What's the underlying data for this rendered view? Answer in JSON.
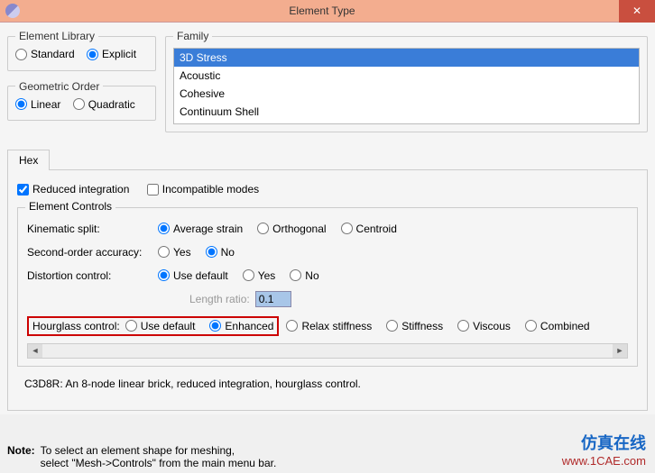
{
  "window": {
    "title": "Element Type",
    "close": "✕"
  },
  "library": {
    "legend": "Element Library",
    "standard": "Standard",
    "explicit": "Explicit"
  },
  "family": {
    "legend": "Family",
    "items": [
      "3D Stress",
      "Acoustic",
      "Cohesive",
      "Continuum Shell"
    ]
  },
  "order": {
    "legend": "Geometric Order",
    "linear": "Linear",
    "quadratic": "Quadratic"
  },
  "tab": {
    "hex": "Hex"
  },
  "checks": {
    "reduced": "Reduced integration",
    "incompatible": "Incompatible modes"
  },
  "controls": {
    "legend": "Element Controls",
    "kin": {
      "label": "Kinematic split:",
      "avg": "Average strain",
      "orth": "Orthogonal",
      "cent": "Centroid"
    },
    "so": {
      "label": "Second-order accuracy:",
      "yes": "Yes",
      "no": "No"
    },
    "dist": {
      "label": "Distortion control:",
      "def": "Use default",
      "yes": "Yes",
      "no": "No"
    },
    "len": {
      "label": "Length ratio:",
      "value": "0.1"
    },
    "hg": {
      "label": "Hourglass control:",
      "def": "Use default",
      "enh": "Enhanced",
      "relax": "Relax stiffness",
      "stiff": "Stiffness",
      "visc": "Viscous",
      "comb": "Combined"
    }
  },
  "desc": "C3D8R:  An 8-node linear brick, reduced integration, hourglass control.",
  "note": {
    "bold": "Note:",
    "l1": "To select an element shape for meshing,",
    "l2": "select \"Mesh->Controls\" from the main menu bar."
  },
  "brand": {
    "cn": "仿真在线",
    "url": "www.1CAE.com"
  },
  "arrows": {
    "l": "◄",
    "r": "►"
  }
}
